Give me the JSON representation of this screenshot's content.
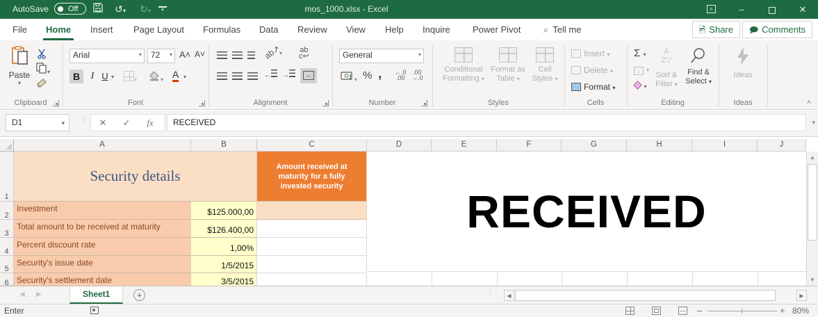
{
  "colors": {
    "excel_green": "#1e6b41",
    "header_orange": "#ED7D31",
    "peach_light": "#FBDFC5",
    "peach": "#F8CBAD",
    "yellow": "#FFFFCC",
    "label_text": "#8A4A21",
    "title_text": "#3F5785"
  },
  "titlebar": {
    "autosave_label": "AutoSave",
    "autosave_state": "Off",
    "title": "mos_1000.xlsx  -  Excel"
  },
  "icons": {
    "undo": "↺",
    "redo": "↻",
    "dropdown": "▾",
    "minimize": "–",
    "close": "✕",
    "cancel": "✕",
    "enter": "✓",
    "fx": "fx",
    "search": "⌕",
    "up_chevron": "˄",
    "up_arrow": "▲",
    "down_arrow": "▼",
    "left_arrow": "◀",
    "right_arrow": "▶",
    "plus": "+",
    "minus": "–"
  },
  "ribbon_tabs": [
    {
      "label": "File"
    },
    {
      "label": "Home"
    },
    {
      "label": "Insert"
    },
    {
      "label": "Page Layout"
    },
    {
      "label": "Formulas"
    },
    {
      "label": "Data"
    },
    {
      "label": "Review"
    },
    {
      "label": "View"
    },
    {
      "label": "Help"
    },
    {
      "label": "Inquire"
    },
    {
      "label": "Power Pivot"
    }
  ],
  "tellme_label": "Tell me",
  "share_label": "Share",
  "comments_label": "Comments",
  "ribbon": {
    "paste_label": "Paste",
    "font_name": "Arial",
    "font_size": "72",
    "bold": "B",
    "italic": "I",
    "underline": "U",
    "font_color_letter": "A",
    "wrap_ab": "ab",
    "number_format": "General",
    "percent": "%",
    "comma": ",",
    "sigma": "Σ",
    "groups": {
      "clipboard": "Clipboard",
      "font": "Font",
      "alignment": "Alignment",
      "number": "Number",
      "styles": "Styles",
      "cells": "Cells",
      "editing": "Editing",
      "ideas": "Ideas"
    },
    "styles_buttons": {
      "conditional_line1": "Conditional",
      "conditional_line2": "Formatting",
      "format_table_line1": "Format as",
      "format_table_line2": "Table",
      "cell_styles_line1": "Cell",
      "cell_styles_line2": "Styles"
    },
    "cells_buttons": {
      "insert": "Insert",
      "delete": "Delete",
      "format": "Format"
    },
    "editing_buttons": {
      "sort_line1": "Sort &",
      "sort_line2": "Filter",
      "find_line1": "Find &",
      "find_line2": "Select"
    },
    "ideas_button": "Ideas"
  },
  "formula_bar": {
    "name_box": "D1",
    "formula": "RECEIVED"
  },
  "grid": {
    "columns": [
      "A",
      "B",
      "C",
      "D",
      "E",
      "F",
      "G",
      "H",
      "I",
      "J"
    ],
    "row_numbers": [
      "1",
      "2",
      "3",
      "4",
      "5",
      "6"
    ],
    "security_details_title": "Security details",
    "c1_header": "Amount received at maturity for a fully invested security",
    "rows": [
      {
        "label": "Investment",
        "value": "$125.000,00"
      },
      {
        "label": "Total amount to be received at maturity",
        "value": "$126.400,00"
      },
      {
        "label": "Percent discount rate",
        "value": "1,00%"
      },
      {
        "label": "Security's issue date",
        "value": "1/5/2015"
      },
      {
        "label": "Security's settlement date",
        "value": "3/5/2015"
      }
    ],
    "big_text": "RECEIVED"
  },
  "sheet_tab_label": "Sheet1",
  "status_bar": {
    "mode": "Enter",
    "zoom_level": "80%"
  }
}
